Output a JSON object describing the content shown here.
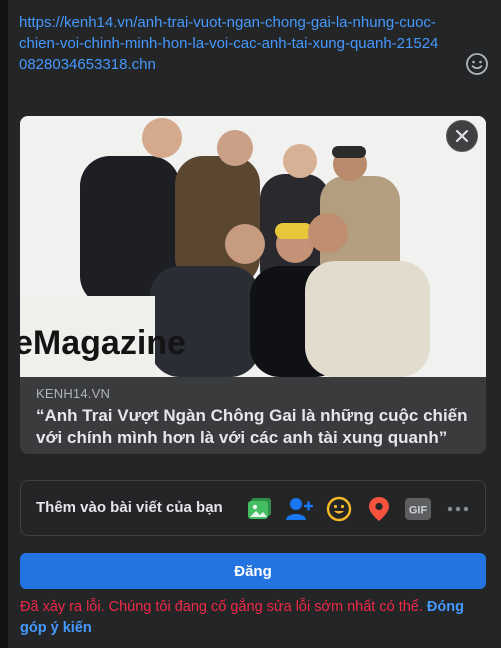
{
  "composer": {
    "url_text": "https://kenh14.vn/anh-trai-vuot-ngan-chong-gai-la-nhung-cuoc-chien-voi-chinh-minh-hon-la-voi-cac-anh-tai-xung-quanh-215240828034653318.chn",
    "emoji_icon": "smiley-icon"
  },
  "link_preview": {
    "image_overlay_text": "eMagazine",
    "domain": "KENH14.VN",
    "title": "“Anh Trai Vượt Ngàn Chông Gai là những cuộc chiến với chính mình hơn là với các anh tài xung quanh”",
    "close_icon": "close-icon"
  },
  "add_to_post": {
    "label": "Thêm vào bài viết của bạn",
    "tools": [
      {
        "name": "photo-video-icon",
        "color": "#45bd62"
      },
      {
        "name": "tag-people-icon",
        "color": "#1877f2"
      },
      {
        "name": "feeling-icon",
        "color": "#f7b928"
      },
      {
        "name": "check-in-icon",
        "color": "#f5533d"
      },
      {
        "name": "gif-icon",
        "color": "#8a8d91",
        "text": "GIF"
      },
      {
        "name": "more-icon",
        "color": "#b0b3b8"
      }
    ]
  },
  "post_button": {
    "label": "Đăng"
  },
  "error": {
    "message": "Đã xảy ra lỗi. Chúng tôi đang cố gắng sửa lỗi sớm nhất có thể.",
    "link": "Đóng góp ý kiến"
  }
}
